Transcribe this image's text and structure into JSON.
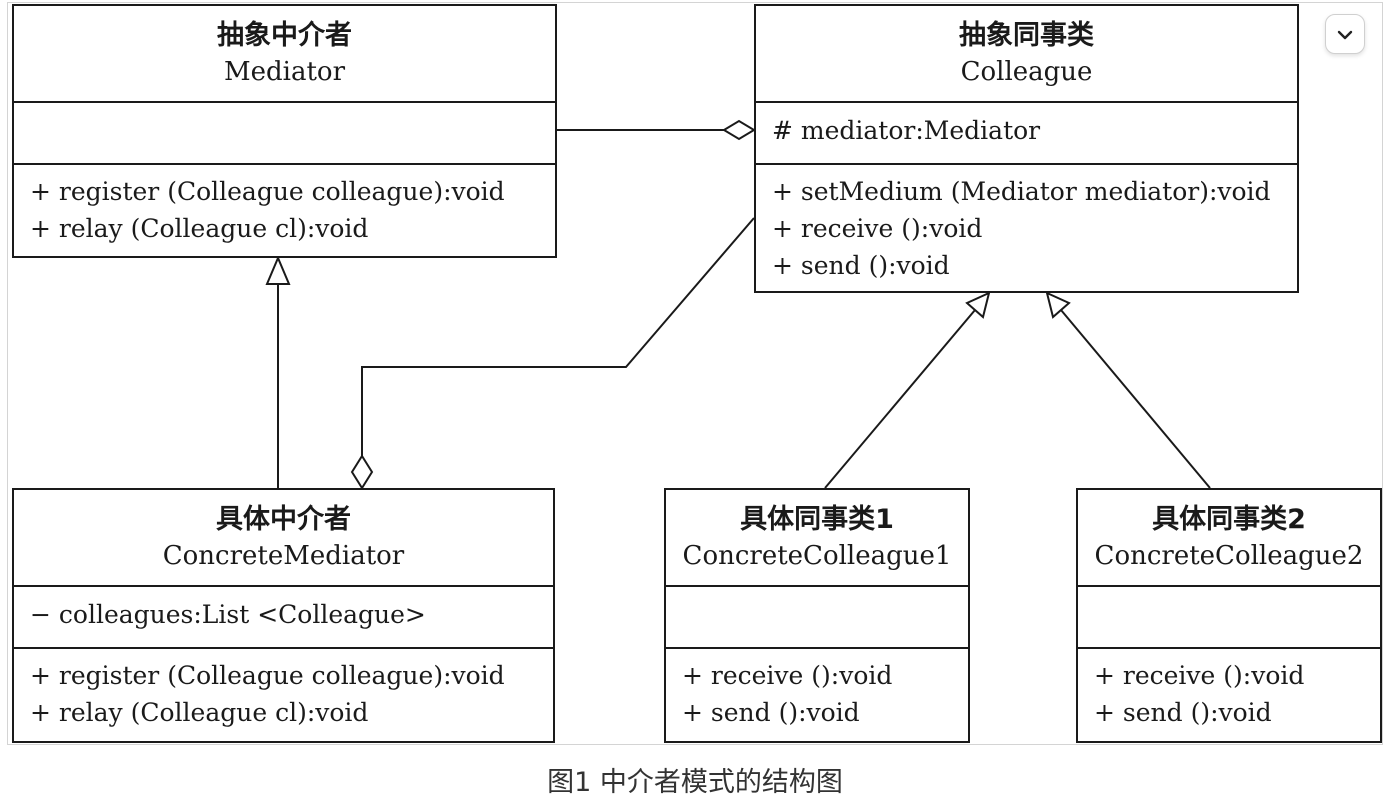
{
  "diagram": {
    "classes": {
      "mediator": {
        "name_cn": "抽象中介者",
        "name_en": "Mediator",
        "attributes": [],
        "methods": [
          "+ register (Colleague colleague):void",
          "+ relay (Colleague cl):void"
        ]
      },
      "colleague": {
        "name_cn": "抽象同事类",
        "name_en": "Colleague",
        "attributes": [
          "# mediator:Mediator"
        ],
        "methods": [
          "+ setMedium (Mediator mediator):void",
          "+ receive ():void",
          "+ send ():void"
        ]
      },
      "concrete_mediator": {
        "name_cn": "具体中介者",
        "name_en": "ConcreteMediator",
        "attributes": [
          "− colleagues:List <Colleague>"
        ],
        "methods": [
          "+ register (Colleague colleague):void",
          "+ relay (Colleague cl):void"
        ]
      },
      "concrete_colleague_1": {
        "name_cn": "具体同事类1",
        "name_en": "ConcreteColleague1",
        "attributes": [],
        "methods": [
          "+ receive ():void",
          "+ send ():void"
        ]
      },
      "concrete_colleague_2": {
        "name_cn": "具体同事类2",
        "name_en": "ConcreteColleague2",
        "attributes": [],
        "methods": [
          "+ receive ():void",
          "+ send ():void"
        ]
      }
    },
    "relations": [
      {
        "type": "aggregation",
        "whole": "Colleague",
        "part": "Mediator"
      },
      {
        "type": "aggregation",
        "whole": "ConcreteMediator",
        "part": "Colleague"
      },
      {
        "type": "generalization",
        "child": "ConcreteMediator",
        "parent": "Mediator"
      },
      {
        "type": "generalization",
        "child": "ConcreteColleague1",
        "parent": "Colleague"
      },
      {
        "type": "generalization",
        "child": "ConcreteColleague2",
        "parent": "Colleague"
      }
    ],
    "caption": "图1 中介者模式的结构图"
  },
  "ui": {
    "collapse_icon": "chevron-down-icon",
    "line_color": "#1a1a1a",
    "frame_border_color": "#d4d4d4"
  }
}
